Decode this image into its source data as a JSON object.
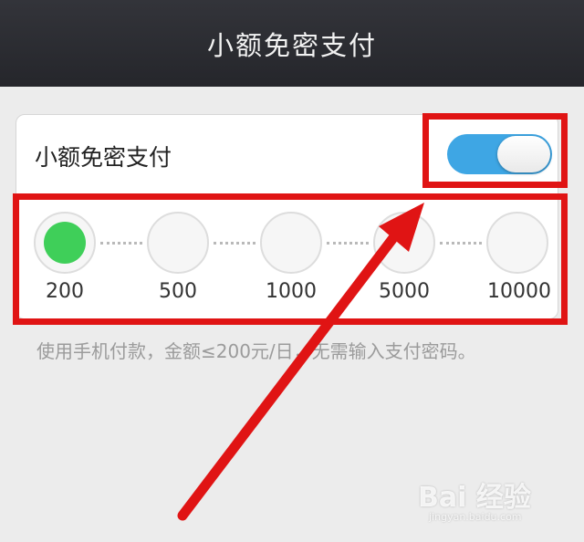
{
  "header": {
    "title": "小额免密支付"
  },
  "setting": {
    "label": "小额免密支付",
    "toggle_on": true,
    "toggle_color": "#3ea6e4"
  },
  "limits": {
    "selected_index": 0,
    "selected_color": "#3fcf59",
    "options": [
      "200",
      "500",
      "1000",
      "5000",
      "10000"
    ]
  },
  "description": "使用手机付款，金额≤200元/日，无需输入支付密码。",
  "annotation": {
    "highlight_color": "#e01414"
  },
  "watermark": {
    "brand": "Bai 经验",
    "url": "jingyan.baidu.com"
  }
}
